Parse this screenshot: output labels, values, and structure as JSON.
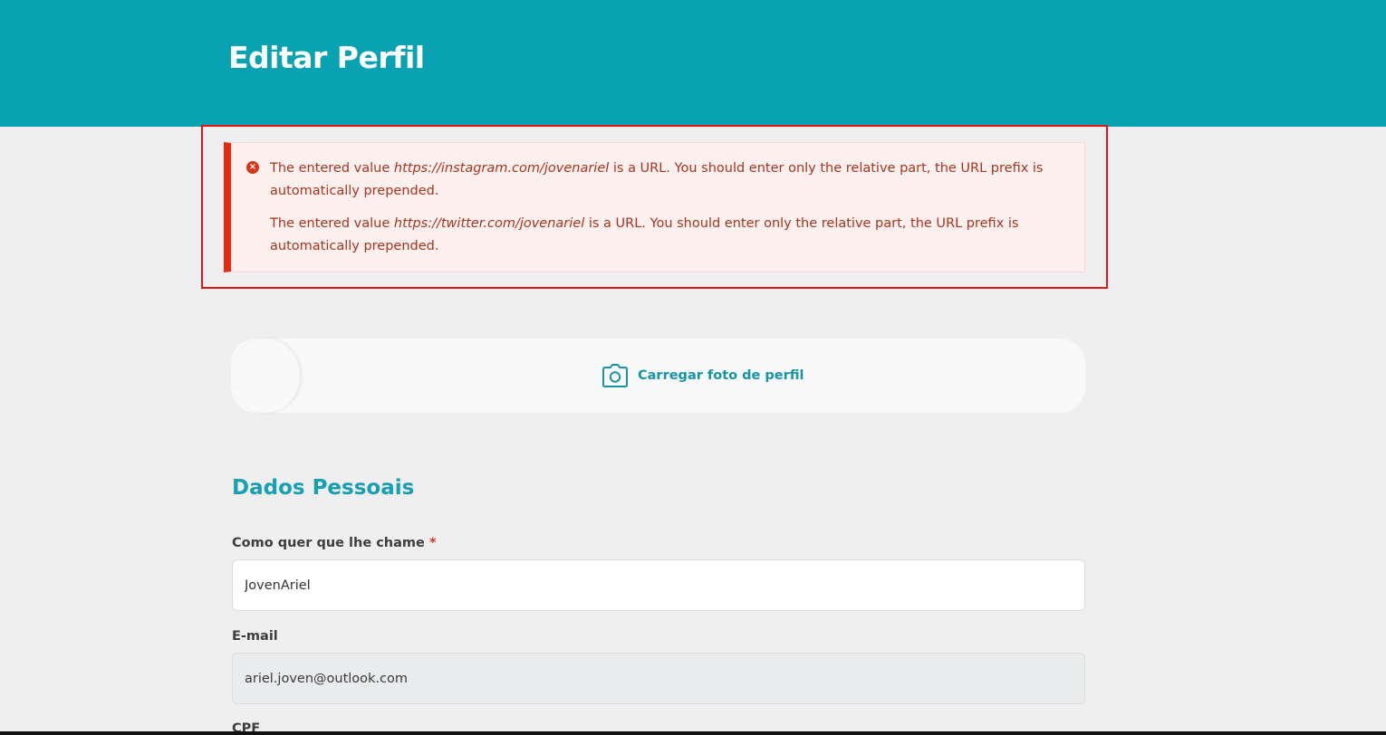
{
  "header": {
    "title": "Editar Perfil"
  },
  "alert": {
    "icon": "error-circle-icon",
    "messages": [
      {
        "prefix": "The entered value ",
        "url": "https://instagram.com/jovenariel",
        "suffix": " is a URL. You should enter only the relative part, the URL prefix is automatically prepended."
      },
      {
        "prefix": "The entered value ",
        "url": "https://twitter.com/jovenariel",
        "suffix": " is a URL. You should enter only the relative part, the URL prefix is automatically prepended."
      }
    ]
  },
  "photo": {
    "upload_label": "Carregar foto de perfil",
    "icon": "camera-icon"
  },
  "section": {
    "title": "Dados Pessoais"
  },
  "fields": {
    "name": {
      "label": "Como quer que lhe chame",
      "required_mark": "*",
      "value": "JovenAriel"
    },
    "email": {
      "label": "E-mail",
      "value": "ariel.joven@outlook.com"
    },
    "cpf": {
      "label": "CPF"
    }
  },
  "colors": {
    "header_bg": "#08a2b3",
    "accent": "#17a0b2",
    "error": "#e8280f"
  }
}
